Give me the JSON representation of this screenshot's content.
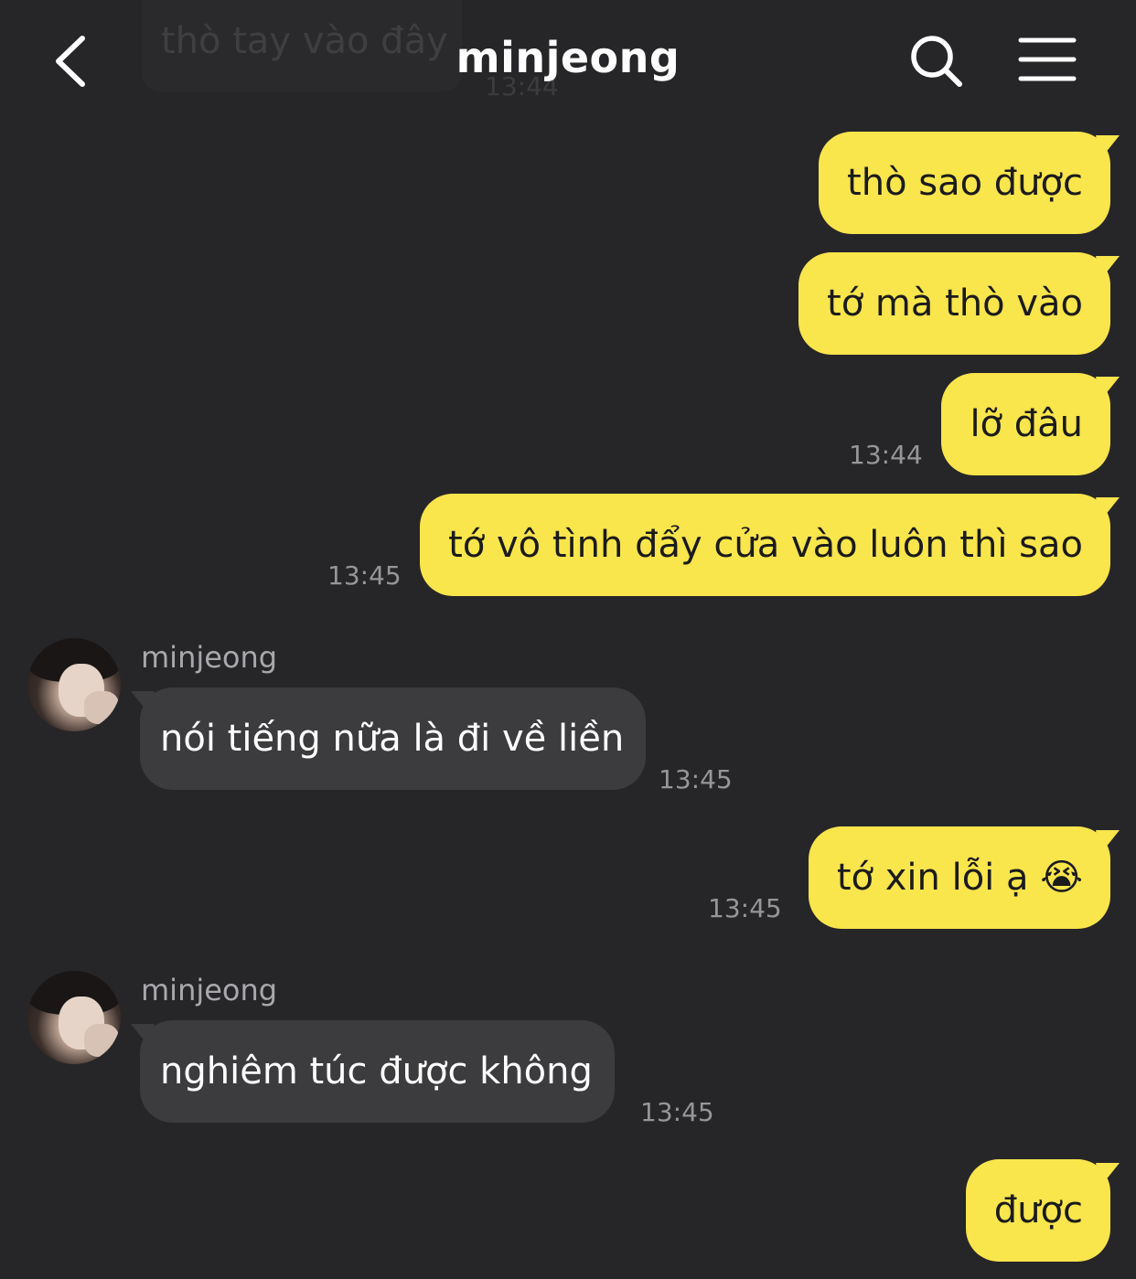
{
  "header": {
    "title": "minjeong",
    "ghost_message": "thò tay vào đây",
    "ghost_time": "13:44",
    "back_icon": "chevron-left-icon",
    "search_icon": "search-icon",
    "menu_icon": "hamburger-menu-icon"
  },
  "messages": [
    {
      "text": "thò sao được"
    },
    {
      "text": "tớ mà thò vào"
    },
    {
      "text": "lỡ đâu",
      "time": "13:44"
    },
    {
      "text": "tớ vô tình đẩy cửa vào luôn thì sao",
      "time": "13:45"
    },
    {
      "sender": "minjeong",
      "text": "nói tiếng nữa là đi về liền",
      "time": "13:45"
    },
    {
      "text": "tớ xin lỗi ạ",
      "emoji": "😭",
      "time": "13:45"
    },
    {
      "sender": "minjeong",
      "text": "nghiêm túc được không",
      "time": "13:45"
    },
    {
      "text": "được"
    }
  ],
  "colors": {
    "background": "#262628",
    "outgoing_bubble": "#f9e54c",
    "incoming_bubble": "#3c3c3e",
    "timestamp": "#96969a"
  }
}
